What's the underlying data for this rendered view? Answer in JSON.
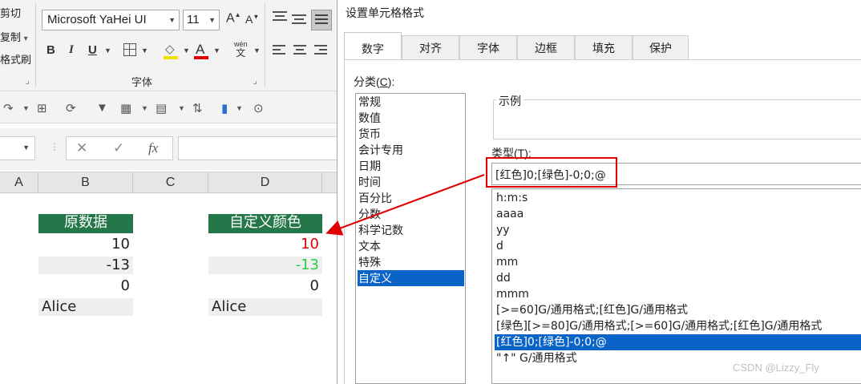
{
  "ribbon": {
    "clipboard": [
      "剪切",
      "复制",
      "格式刷"
    ],
    "copy_dropdown": "▾",
    "font_name": "Microsoft YaHei UI",
    "font_size": "11",
    "grow_font": "A",
    "shrink_font": "A",
    "bold": "B",
    "italic": "I",
    "underline": "U",
    "font_color_letter": "A",
    "phonetic_top": "wén",
    "phonetic_bottom": "文",
    "font_group_label": "字体",
    "launcher": "⌟",
    "font_color": "#e00000"
  },
  "formula_bar": {
    "cancel": "✕",
    "enter": "✓",
    "fx": "fx"
  },
  "columns": [
    "A",
    "B",
    "C",
    "D"
  ],
  "sheet": {
    "b_header": "原数据",
    "d_header": "自定义颜色",
    "rows": [
      {
        "b": "10",
        "d": "10"
      },
      {
        "b": "-13",
        "d": "-13"
      },
      {
        "b": "0",
        "d": "0"
      },
      {
        "b": "Alice",
        "d": "Alice"
      }
    ],
    "header_bg": "#237748",
    "pos_color": "#e00000",
    "neg_color": "#22cc44"
  },
  "dialog": {
    "title": "设置单元格格式",
    "tabs": [
      "数字",
      "对齐",
      "字体",
      "边框",
      "填充",
      "保护"
    ],
    "active_tab": "数字",
    "category_label": "分类(C):",
    "category_label_prefix": "分类(",
    "category_label_key": "C",
    "category_label_suffix": "):",
    "categories": [
      "常规",
      "数值",
      "货币",
      "会计专用",
      "日期",
      "时间",
      "百分比",
      "分数",
      "科学记数",
      "文本",
      "特殊",
      "自定义"
    ],
    "selected_category": "自定义",
    "sample_label": "示例",
    "type_label_prefix": "类型(",
    "type_label_key": "T",
    "type_label_suffix": "):",
    "type_value": "[红色]0;[绿色]-0;0;@",
    "type_list": [
      "h:m:s",
      "aaaa",
      "yy",
      "d",
      "mm",
      "dd",
      "mmm",
      "[>=60]G/通用格式;[红色]G/通用格式",
      "[绿色][>=80]G/通用格式;[>=60]G/通用格式;[红色]G/通用格式",
      "[红色]0;[绿色]-0;0;@",
      "\"↑\" G/通用格式"
    ],
    "selected_type_index": 9,
    "highlight_color": "#e00000",
    "selection_color": "#0a64c8"
  },
  "watermark": "CSDN @Lizzy_Fly"
}
